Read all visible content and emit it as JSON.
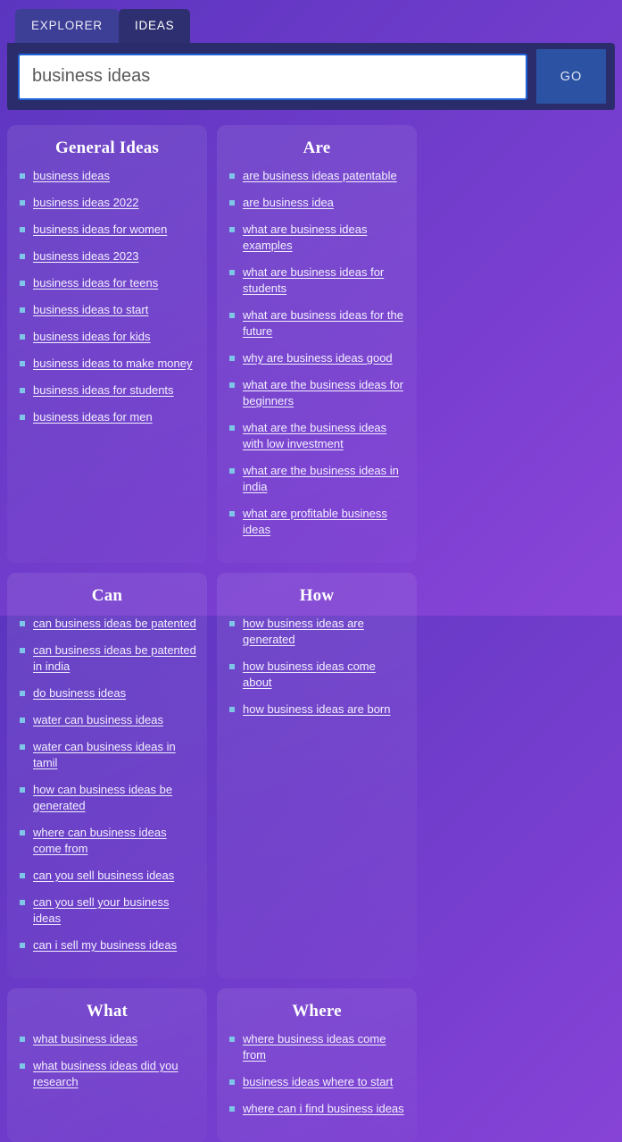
{
  "tabs": [
    {
      "label": "EXPLORER",
      "active": false
    },
    {
      "label": "IDEAS",
      "active": true
    }
  ],
  "search": {
    "value": "business ideas",
    "placeholder": "business ideas",
    "go_label": "GO"
  },
  "cards": [
    {
      "title": "General Ideas",
      "items": [
        "business ideas",
        "business ideas 2022",
        "business ideas for women",
        "business ideas 2023",
        "business ideas for teens",
        "business ideas to start",
        "business ideas for kids",
        "business ideas to make money",
        "business ideas for students",
        "business ideas for men"
      ]
    },
    {
      "title": "Are",
      "items": [
        "are business ideas patentable",
        "are business idea",
        "what are business ideas examples",
        "what are business ideas for students",
        "what are business ideas for the future",
        "why are business ideas good",
        "what are the business ideas for beginners",
        "what are the business ideas with low investment",
        "what are the business ideas in india",
        "what are profitable business ideas"
      ]
    },
    {
      "title": "Can",
      "items": [
        "can business ideas be patented",
        "can business ideas be patented in india",
        "do business ideas",
        "water can business ideas",
        "water can business ideas in tamil",
        "how can business ideas be generated",
        "where can business ideas come from",
        "can you sell business ideas",
        "can you sell your business ideas",
        "can i sell my business ideas"
      ]
    },
    {
      "title": "How",
      "items": [
        "how business ideas are generated",
        "how business ideas come about",
        "how business ideas are born"
      ]
    },
    {
      "title": "What",
      "items": [
        "what business ideas",
        "what business ideas did you research"
      ]
    },
    {
      "title": "Where",
      "items": [
        "where business ideas come from",
        "business ideas where to start",
        "where can i find business ideas"
      ]
    }
  ],
  "colors": {
    "page_background_start": "#5b35bf",
    "page_background_end": "#8a45d8",
    "tab_inactive": "#3d3f96",
    "tab_active": "#2e2f70",
    "search_panel": "#2b2c6b",
    "search_border": "#1f63d6",
    "go_button": "#2b52a3",
    "bullet": "#7ec5e8",
    "link_text": "#f2f0ff"
  }
}
